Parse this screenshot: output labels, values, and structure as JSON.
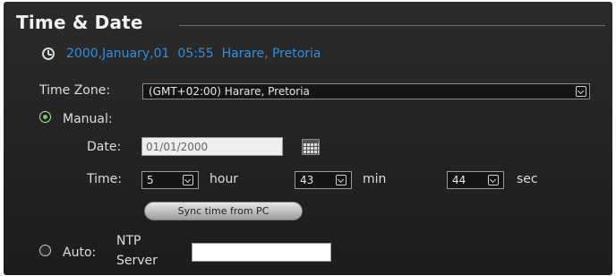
{
  "page": {
    "title": "Time & Date",
    "current_datetime": "2000,January,01  05:55  Harare, Pretoria"
  },
  "time_zone": {
    "label": "Time Zone:",
    "selected": "(GMT+02:00) Harare, Pretoria"
  },
  "manual": {
    "label": "Manual:",
    "selected": true,
    "date_label": "Date:",
    "date_value": "01/01/2000",
    "time_label": "Time:",
    "hour_value": "5",
    "hour_unit": "hour",
    "min_value": "43",
    "min_unit": "min",
    "sec_value": "44",
    "sec_unit": "sec",
    "sync_button": "Sync time from PC"
  },
  "auto": {
    "label": "Auto:",
    "selected": false,
    "ntp_label_line1": "NTP",
    "ntp_label_line2": "Server",
    "ntp_value": ""
  },
  "colors": {
    "background": "#222222",
    "accent_blue": "#2f8fe0",
    "radio_selected": "#6fd15a"
  },
  "icons": {
    "clock": "clock-icon",
    "calendar": "calendar-icon",
    "dropdown": "chevron-down-icon"
  }
}
